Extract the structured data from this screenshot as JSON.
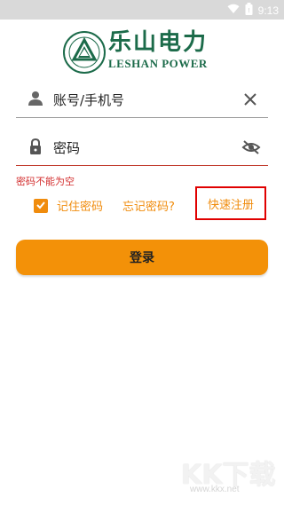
{
  "status_bar": {
    "time": "9:13",
    "icons": [
      "wifi-icon",
      "battery-icon"
    ]
  },
  "brand": {
    "name_cn": "乐山电力",
    "name_en": "LESHAN POWER",
    "logo_color": "#1c6b4a"
  },
  "account_field": {
    "placeholder": "账号/手机号",
    "lead_icon": "person-icon",
    "trail_icon": "clear-icon"
  },
  "password_field": {
    "placeholder": "密码",
    "lead_icon": "lock-icon",
    "trail_icon": "visibility-off-icon"
  },
  "error_text": "密码不能为空",
  "remember": {
    "label": "记住密码",
    "checked": true
  },
  "forgot_label": "忘记密码?",
  "register_label": "快速注册",
  "login_label": "登录",
  "watermark": {
    "main": "KK下载",
    "url": "www.kkx.net"
  },
  "colors": {
    "accent": "#f08c0d",
    "button": "#f39108",
    "error": "#d32f2f",
    "highlight_box": "#e00000"
  }
}
